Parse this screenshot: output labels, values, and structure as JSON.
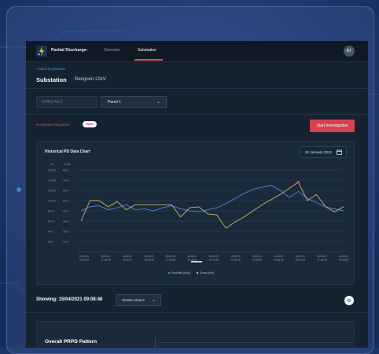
{
  "header": {
    "app_name": "Partial Discharge",
    "app_caret": "⌄",
    "tabs": [
      {
        "label": "Overview",
        "active": false
      },
      {
        "label": "Substation",
        "active": true
      }
    ],
    "avatar_initials": "RT"
  },
  "page": {
    "back_label": "< Back to previous",
    "title": "Substation",
    "subtitle": "Rangoon 22kV"
  },
  "filters": {
    "select_1_value": "SWBD ML3",
    "select_2_value": "Panel 1",
    "caret": "⌄"
  },
  "alert": {
    "label": "● Attention Required",
    "badge": "HIGH",
    "button_label": "Start Investigation"
  },
  "chart_panel": {
    "title": "Historical PD Data Chart",
    "date_value": "20 January 2021"
  },
  "chart_data": {
    "type": "line",
    "title": "Historical PD Data Chart",
    "y_left_ticks": [
      "1.6e-8",
      "1.4e-8",
      "1.2e-8",
      "1.0e-8",
      "8e-9",
      "6e-9",
      "4e-9",
      "2e-9"
    ],
    "y_right_ticks": [
      "8e+3",
      "7e+3",
      "6e+3",
      "5e+3",
      "4e+3",
      "3e+3",
      "2e+3",
      "1e+3"
    ],
    "y_header": [
      "mV",
      "Rate"
    ],
    "x_ticks": [
      "15/01/21\n09:08:48",
      "15/01/21\n11:08:48",
      "15/01/21\n13:08:47",
      "15/01/21\n15:08:48",
      "15/01/21\n17:08:48",
      "15/01/21\n19:08:48",
      "15/01/21\n21:08:48",
      "15/01/21\n23:08:48",
      "16/01/21\n01:08:48",
      "16/01/21\n03:08:48",
      "16/01/21\n05:08:48",
      "16/01/21\n07:08:48",
      "16/01/21\n09:08:48"
    ],
    "ylim": [
      0,
      8
    ],
    "series": [
      {
        "name": "RepRate [Nr/s]",
        "color": "#4f82e6",
        "values": [
          4.0,
          4.4,
          4.5,
          4.1,
          4.3,
          4.6,
          4.1,
          4.2,
          4.0,
          4.3,
          4.5,
          4.2,
          4.0,
          3.9,
          4.1,
          4.3,
          4.7,
          5.2,
          5.7,
          6.1,
          6.3,
          6.5,
          6.0,
          5.3,
          5.9,
          5.2,
          4.8,
          4.4,
          4.2,
          4.0
        ]
      },
      {
        "name": "Qmax [mV]",
        "color": "#c9b45d",
        "values": [
          3.0,
          5.0,
          5.0,
          4.4,
          4.9,
          4.1,
          4.6,
          4.6,
          4.6,
          4.6,
          4.6,
          3.4,
          4.3,
          4.4,
          3.7,
          3.6,
          2.3,
          2.9,
          3.4,
          4.0,
          4.6,
          5.1,
          5.6,
          6.2,
          6.8,
          5.0,
          5.6,
          4.4,
          3.9,
          4.4
        ]
      }
    ]
  },
  "showing": {
    "label": "Showing: 15/04/2021 09:08:48",
    "cluster_value": "Cluster View 2",
    "caret": "⌄"
  },
  "prpd": {
    "title": "Overall PRPD Pattern"
  }
}
